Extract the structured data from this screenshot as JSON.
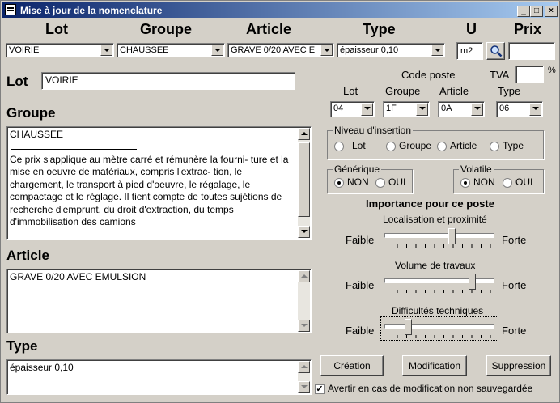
{
  "window": {
    "title": "Mise à jour de la nomenclature"
  },
  "top_headers": {
    "lot": "Lot",
    "groupe": "Groupe",
    "article": "Article",
    "type": "Type",
    "u": "U",
    "prix": "Prix"
  },
  "top_combos": {
    "lot": "VOIRIE",
    "groupe": "CHAUSSEE",
    "article": "GRAVE 0/20  AVEC E",
    "type": "épaisseur 0,10"
  },
  "unit_value": "m2",
  "prix_value": "",
  "lot_section": {
    "label": "Lot",
    "value": "VOIRIE"
  },
  "groupe_section": {
    "label": "Groupe",
    "title_line": "CHAUSSEE",
    "text": "Ce prix s'applique au mètre carré et rémunère la fourni- ture et la mise en oeuvre de matériaux, compris l'extrac- tion, le chargement, le transport à pied d'oeuvre, le régalage, le compactage et le réglage. Il tient compte de toutes sujétions de recherche d'emprunt, du droit d'extraction, du temps d'immobilisation des camions"
  },
  "article_section": {
    "label": "Article",
    "text": "GRAVE 0/20  AVEC EMULSION"
  },
  "type_section": {
    "label": "Type",
    "text": "épaisseur 0,10"
  },
  "code_poste": {
    "label": "Code poste",
    "tva_label": "TVA",
    "tva_value": "",
    "percent": "%",
    "sub_labels": {
      "lot": "Lot",
      "groupe": "Groupe",
      "article": "Article",
      "type": "Type"
    },
    "values": {
      "lot": "04",
      "groupe": "1F",
      "article": "0A",
      "type": "06"
    }
  },
  "niveau": {
    "label": "Niveau d'insertion",
    "options": [
      "Lot",
      "Groupe",
      "Article",
      "Type"
    ]
  },
  "generique": {
    "label": "Générique",
    "non": "NON",
    "oui": "OUI",
    "selected": "NON"
  },
  "volatile": {
    "label": "Volatile",
    "non": "NON",
    "oui": "OUI",
    "selected": "NON"
  },
  "importance": {
    "title": "Importance pour ce poste",
    "sliders": [
      {
        "label": "Localisation et proximité",
        "low": "Faible",
        "high": "Forte",
        "level": 0.62
      },
      {
        "label": "Volume de travaux",
        "low": "Faible",
        "high": "Forte",
        "level": 0.82
      },
      {
        "label": "Difficultés techniques",
        "low": "Faible",
        "high": "Forte",
        "level": 0.2
      }
    ]
  },
  "buttons": {
    "creation": "Création",
    "modification": "Modification",
    "suppression": "Suppression"
  },
  "warn_checkbox": {
    "label": "Avertir en cas de modification non sauvegardée",
    "checked": true
  },
  "colors": {
    "titlebar_start": "#0a246a",
    "titlebar_end": "#a6caf0",
    "face": "#d4d0c8"
  }
}
